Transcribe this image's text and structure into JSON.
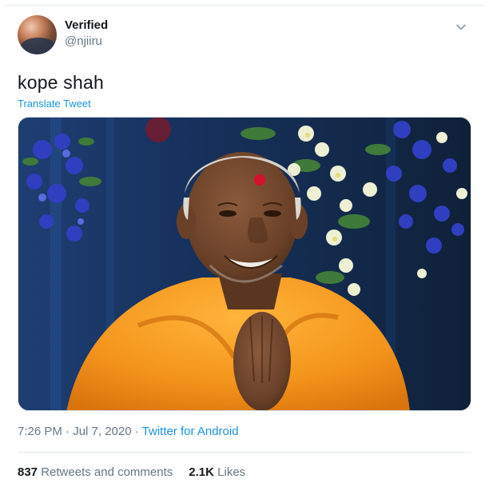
{
  "user": {
    "name": "Verified",
    "handle": "@njiiru"
  },
  "tweet": {
    "text": "kope shah",
    "translate_label": "Translate Tweet",
    "time": "7:26 PM · Jul 7, 2020 ·",
    "source": "Twitter for Android"
  },
  "stats": {
    "retweets_count": "837",
    "retweets_label": "Retweets and comments",
    "likes_count": "2.1K",
    "likes_label": "Likes"
  },
  "icons": {
    "caret": "chevron-down-icon"
  },
  "colors": {
    "link": "#1b95e0",
    "muted": "#657786",
    "robe": "#f39a1f",
    "tilak": "#d4102a"
  }
}
